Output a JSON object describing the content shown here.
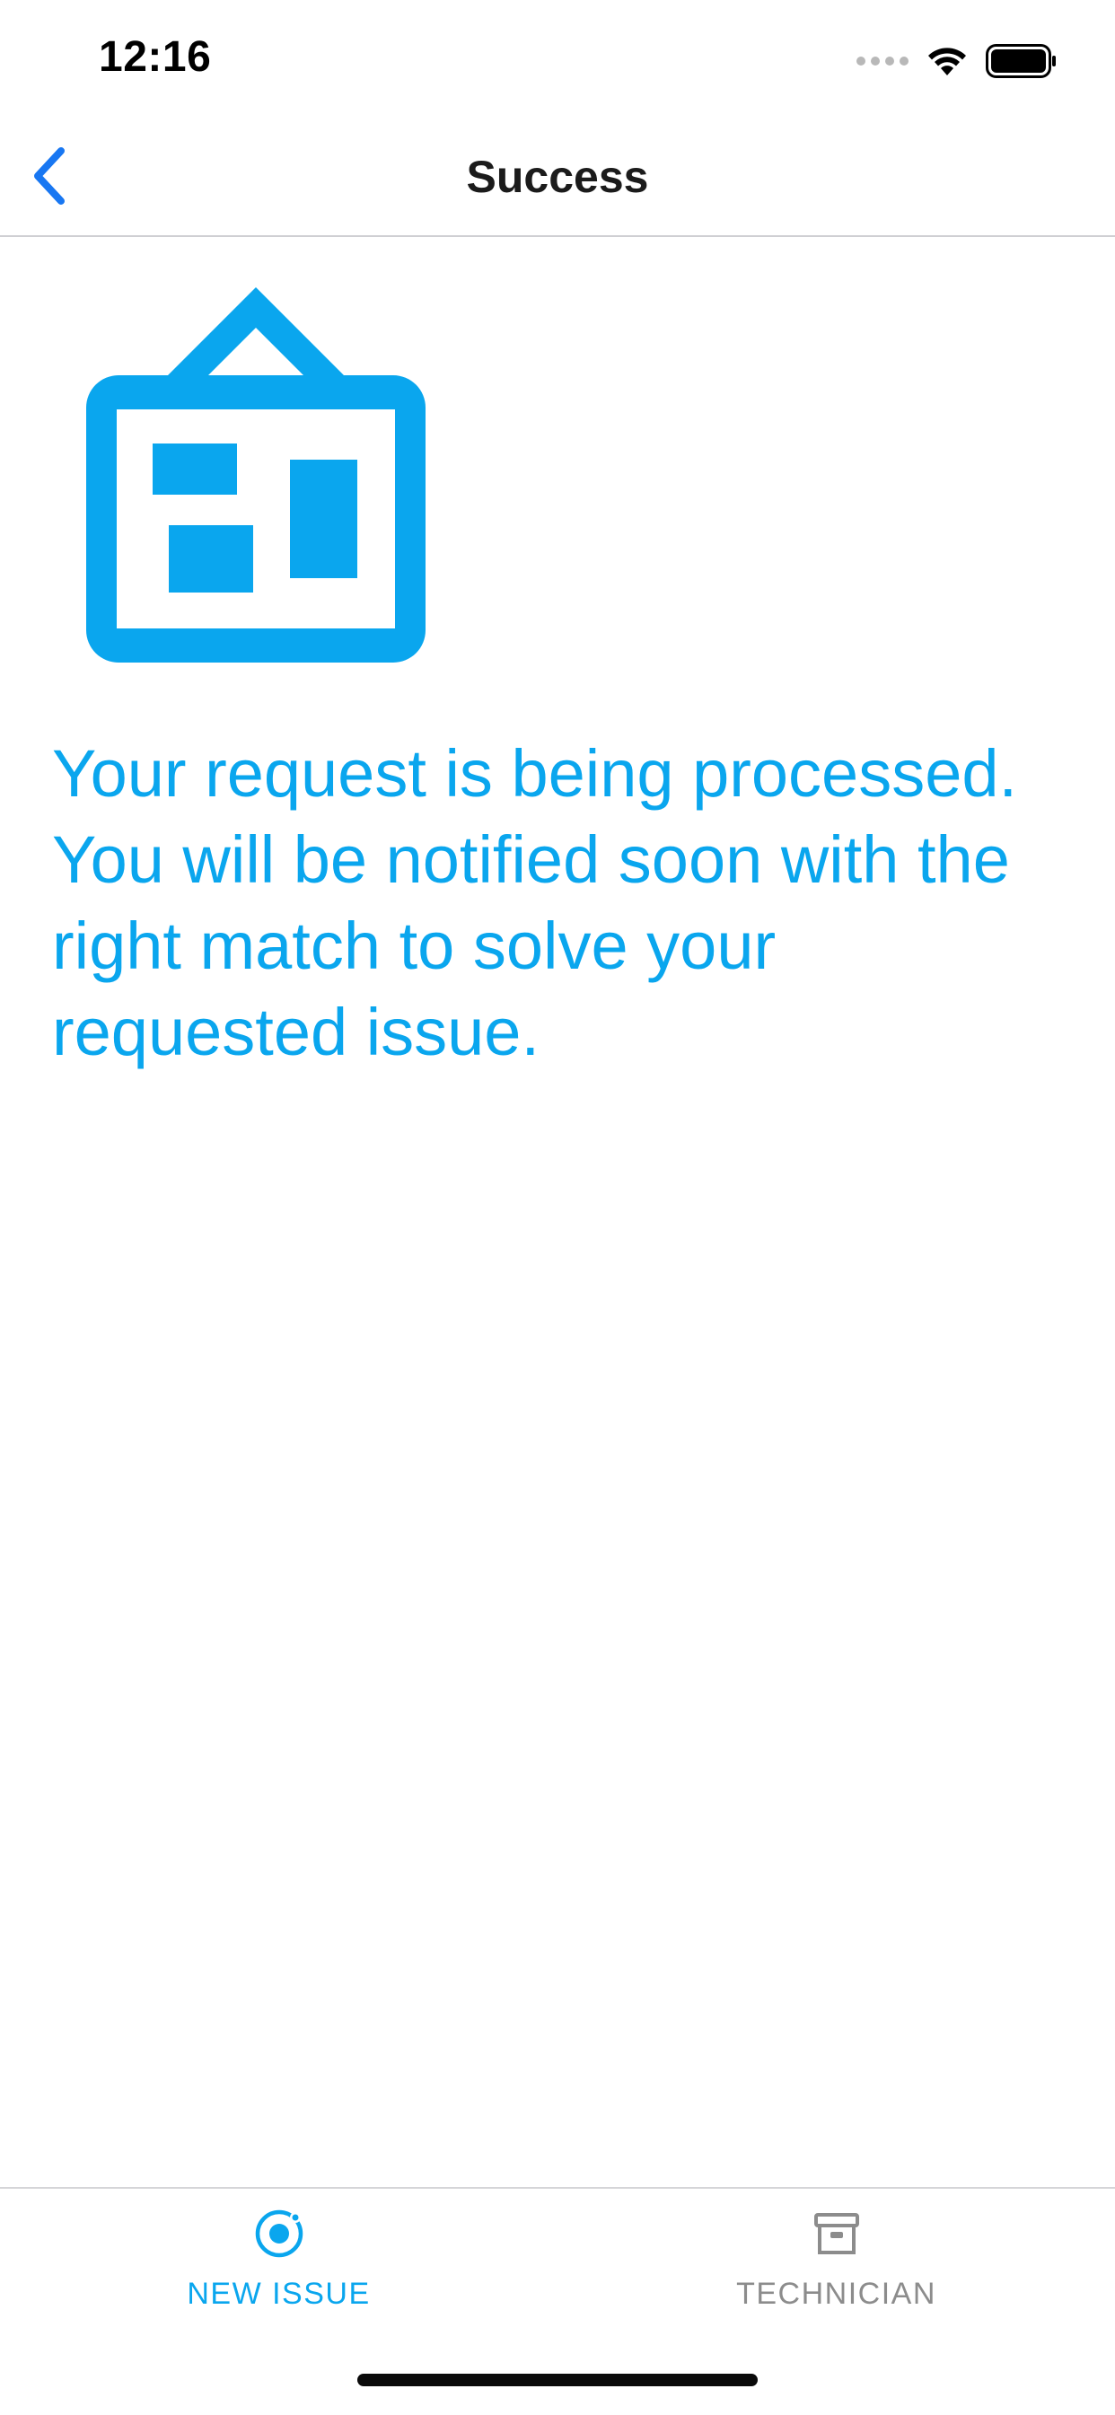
{
  "status_bar": {
    "time": "12:16"
  },
  "nav": {
    "title": "Success",
    "back_icon": "chevron-left-icon"
  },
  "content": {
    "illustration_icon": "dashboard-board-icon",
    "message": "Your request is being processed. You will be notified soon with the right match to solve your requested issue."
  },
  "tabs": [
    {
      "label": "NEW ISSUE",
      "icon": "radio-target-icon",
      "active": true
    },
    {
      "label": "TECHNICIAN",
      "icon": "archive-box-icon",
      "active": false
    }
  ],
  "colors": {
    "accent": "#0AA6EE",
    "ios_blue": "#1877F2",
    "inactive_tab": "#8C8C8C",
    "title_text": "#1B1B1B"
  }
}
